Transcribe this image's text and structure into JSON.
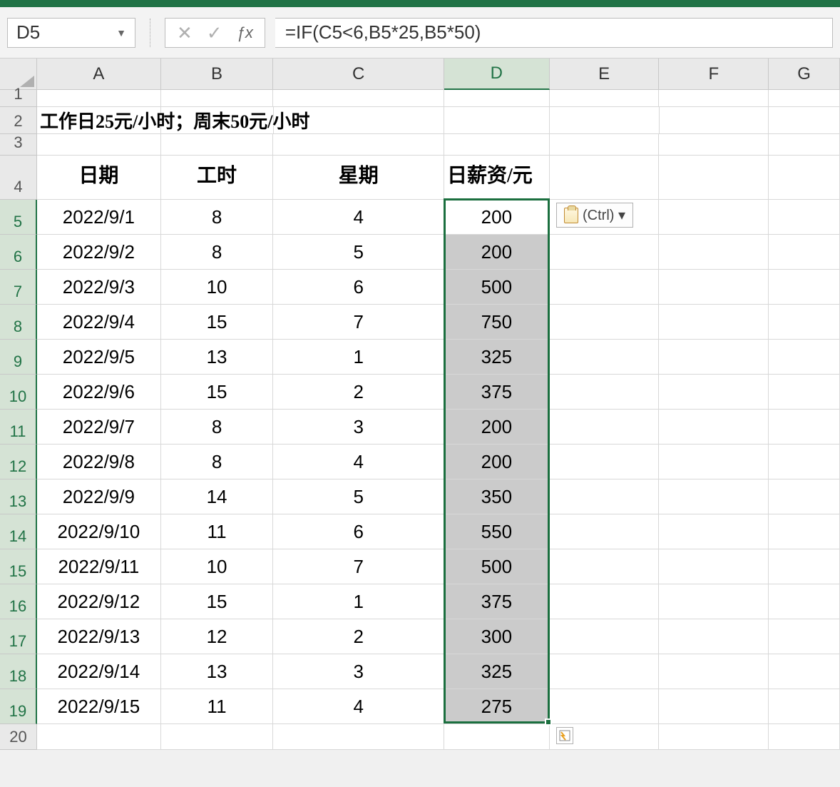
{
  "nameBox": "D5",
  "formula": "=IF(C5<6,B5*25,B5*50)",
  "columns": [
    "A",
    "B",
    "C",
    "D",
    "E",
    "F",
    "G"
  ],
  "activeColumn": "D",
  "rowNumbers": [
    1,
    2,
    3,
    4,
    5,
    6,
    7,
    8,
    9,
    10,
    11,
    12,
    13,
    14,
    15,
    16,
    17,
    18,
    19,
    20
  ],
  "activeRowsStart": 5,
  "activeRowsEnd": 19,
  "titleText": "工作日25元/小时；周末50元/小时",
  "headers": {
    "A": "日期",
    "B": "工时",
    "C": "星期",
    "D": "日薪资/元"
  },
  "tableRows": [
    {
      "A": "2022/9/1",
      "B": "8",
      "C": "4",
      "D": "200"
    },
    {
      "A": "2022/9/2",
      "B": "8",
      "C": "5",
      "D": "200"
    },
    {
      "A": "2022/9/3",
      "B": "10",
      "C": "6",
      "D": "500"
    },
    {
      "A": "2022/9/4",
      "B": "15",
      "C": "7",
      "D": "750"
    },
    {
      "A": "2022/9/5",
      "B": "13",
      "C": "1",
      "D": "325"
    },
    {
      "A": "2022/9/6",
      "B": "15",
      "C": "2",
      "D": "375"
    },
    {
      "A": "2022/9/7",
      "B": "8",
      "C": "3",
      "D": "200"
    },
    {
      "A": "2022/9/8",
      "B": "8",
      "C": "4",
      "D": "200"
    },
    {
      "A": "2022/9/9",
      "B": "14",
      "C": "5",
      "D": "350"
    },
    {
      "A": "2022/9/10",
      "B": "11",
      "C": "6",
      "D": "550"
    },
    {
      "A": "2022/9/11",
      "B": "10",
      "C": "7",
      "D": "500"
    },
    {
      "A": "2022/9/12",
      "B": "15",
      "C": "1",
      "D": "375"
    },
    {
      "A": "2022/9/13",
      "B": "12",
      "C": "2",
      "D": "300"
    },
    {
      "A": "2022/9/14",
      "B": "13",
      "C": "3",
      "D": "325"
    },
    {
      "A": "2022/9/15",
      "B": "11",
      "C": "4",
      "D": "275"
    }
  ],
  "pasteBadge": "(Ctrl) ▾",
  "colWidths": {
    "A": 174,
    "B": 158,
    "C": 240,
    "D": 148,
    "E": 154,
    "F": 154,
    "G": 100
  }
}
